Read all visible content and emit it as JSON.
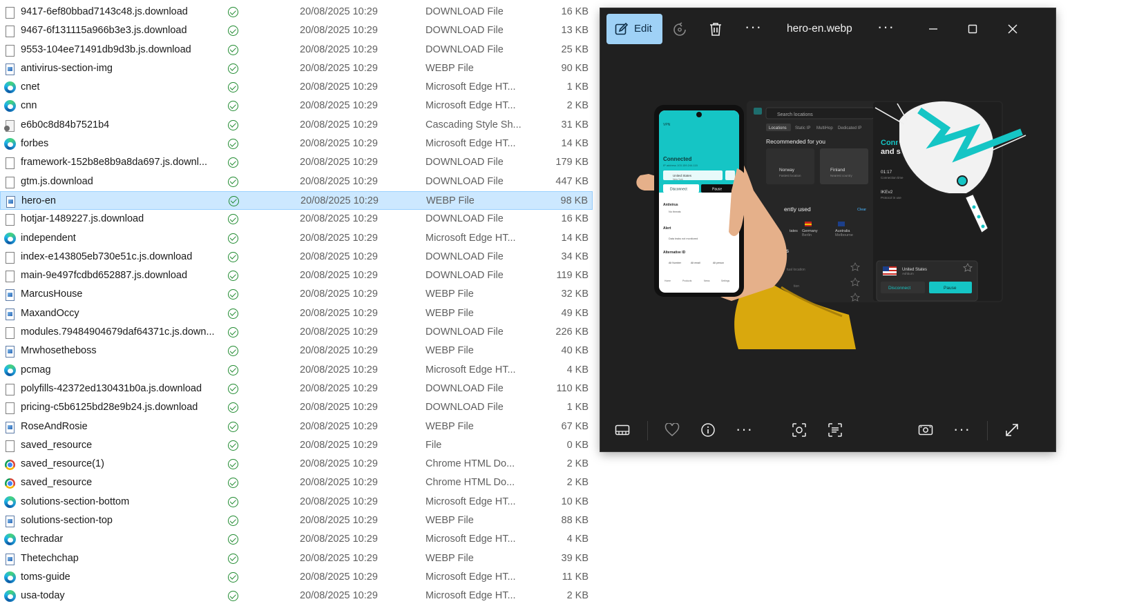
{
  "file_list": {
    "rows": [
      {
        "name": "9417-6ef80bbad7143c48.js.download",
        "icon": "doc",
        "date": "20/08/2025 10:29",
        "type": "DOWNLOAD File",
        "size": "16 KB"
      },
      {
        "name": "9467-6f131115a966b3e3.js.download",
        "icon": "doc",
        "date": "20/08/2025 10:29",
        "type": "DOWNLOAD File",
        "size": "13 KB"
      },
      {
        "name": "9553-104ee71491db9d3b.js.download",
        "icon": "doc",
        "date": "20/08/2025 10:29",
        "type": "DOWNLOAD File",
        "size": "25 KB"
      },
      {
        "name": "antivirus-section-img",
        "icon": "img",
        "date": "20/08/2025 10:29",
        "type": "WEBP File",
        "size": "90 KB"
      },
      {
        "name": "cnet",
        "icon": "edge",
        "date": "20/08/2025 10:29",
        "type": "Microsoft Edge HT...",
        "size": "1 KB"
      },
      {
        "name": "cnn",
        "icon": "edge",
        "date": "20/08/2025 10:29",
        "type": "Microsoft Edge HT...",
        "size": "2 KB"
      },
      {
        "name": "e6b0c8d84b7521b4",
        "icon": "css",
        "date": "20/08/2025 10:29",
        "type": "Cascading Style Sh...",
        "size": "31 KB"
      },
      {
        "name": "forbes",
        "icon": "edge",
        "date": "20/08/2025 10:29",
        "type": "Microsoft Edge HT...",
        "size": "14 KB"
      },
      {
        "name": "framework-152b8e8b9a8da697.js.downl...",
        "icon": "doc",
        "date": "20/08/2025 10:29",
        "type": "DOWNLOAD File",
        "size": "179 KB"
      },
      {
        "name": "gtm.js.download",
        "icon": "doc",
        "date": "20/08/2025 10:29",
        "type": "DOWNLOAD File",
        "size": "447 KB"
      },
      {
        "name": "hero-en",
        "icon": "img",
        "date": "20/08/2025 10:29",
        "type": "WEBP File",
        "size": "98 KB",
        "selected": true
      },
      {
        "name": "hotjar-1489227.js.download",
        "icon": "doc",
        "date": "20/08/2025 10:29",
        "type": "DOWNLOAD File",
        "size": "16 KB"
      },
      {
        "name": "independent",
        "icon": "edge",
        "date": "20/08/2025 10:29",
        "type": "Microsoft Edge HT...",
        "size": "14 KB"
      },
      {
        "name": "index-e143805eb730e51c.js.download",
        "icon": "doc",
        "date": "20/08/2025 10:29",
        "type": "DOWNLOAD File",
        "size": "34 KB"
      },
      {
        "name": "main-9e497fcdbd652887.js.download",
        "icon": "doc",
        "date": "20/08/2025 10:29",
        "type": "DOWNLOAD File",
        "size": "119 KB"
      },
      {
        "name": "MarcusHouse",
        "icon": "img",
        "date": "20/08/2025 10:29",
        "type": "WEBP File",
        "size": "32 KB"
      },
      {
        "name": "MaxandOccy",
        "icon": "img",
        "date": "20/08/2025 10:29",
        "type": "WEBP File",
        "size": "49 KB"
      },
      {
        "name": "modules.79484904679daf64371c.js.down...",
        "icon": "doc",
        "date": "20/08/2025 10:29",
        "type": "DOWNLOAD File",
        "size": "226 KB"
      },
      {
        "name": "Mrwhosetheboss",
        "icon": "img",
        "date": "20/08/2025 10:29",
        "type": "WEBP File",
        "size": "40 KB"
      },
      {
        "name": "pcmag",
        "icon": "edge",
        "date": "20/08/2025 10:29",
        "type": "Microsoft Edge HT...",
        "size": "4 KB"
      },
      {
        "name": "polyfills-42372ed130431b0a.js.download",
        "icon": "doc",
        "date": "20/08/2025 10:29",
        "type": "DOWNLOAD File",
        "size": "110 KB"
      },
      {
        "name": "pricing-c5b6125bd28e9b24.js.download",
        "icon": "doc",
        "date": "20/08/2025 10:29",
        "type": "DOWNLOAD File",
        "size": "1 KB"
      },
      {
        "name": "RoseAndRosie",
        "icon": "img",
        "date": "20/08/2025 10:29",
        "type": "WEBP File",
        "size": "67 KB"
      },
      {
        "name": "saved_resource",
        "icon": "doc",
        "date": "20/08/2025 10:29",
        "type": "File",
        "size": "0 KB"
      },
      {
        "name": "saved_resource(1)",
        "icon": "chrome",
        "date": "20/08/2025 10:29",
        "type": "Chrome HTML Do...",
        "size": "2 KB"
      },
      {
        "name": "saved_resource",
        "icon": "chrome",
        "date": "20/08/2025 10:29",
        "type": "Chrome HTML Do...",
        "size": "2 KB"
      },
      {
        "name": "solutions-section-bottom",
        "icon": "edge",
        "date": "20/08/2025 10:29",
        "type": "Microsoft Edge HT...",
        "size": "10 KB"
      },
      {
        "name": "solutions-section-top",
        "icon": "img",
        "date": "20/08/2025 10:29",
        "type": "WEBP File",
        "size": "88 KB"
      },
      {
        "name": "techradar",
        "icon": "edge",
        "date": "20/08/2025 10:29",
        "type": "Microsoft Edge HT...",
        "size": "4 KB"
      },
      {
        "name": "Thetechchap",
        "icon": "img",
        "date": "20/08/2025 10:29",
        "type": "WEBP File",
        "size": "39 KB"
      },
      {
        "name": "toms-guide",
        "icon": "edge",
        "date": "20/08/2025 10:29",
        "type": "Microsoft Edge HT...",
        "size": "11 KB"
      },
      {
        "name": "usa-today",
        "icon": "edge",
        "date": "20/08/2025 10:29",
        "type": "Microsoft Edge HT...",
        "size": "2 KB"
      }
    ]
  },
  "viewer": {
    "title": "hero-en.webp",
    "edit_label": "Edit",
    "toolbar_icons": [
      "edit-pen-icon",
      "rotate-icon",
      "trash-icon",
      "more-icon",
      "more-icon",
      "minimize-icon",
      "maximize-icon",
      "close-icon"
    ],
    "bottom_icons": [
      "filmstrip-icon",
      "heart-icon",
      "info-icon",
      "more-icon",
      "visual-search-icon",
      "text-scan-icon",
      "slideshow-icon",
      "more-icon",
      "fullscreen-icon"
    ],
    "image": {
      "phone": {
        "app": "VPN",
        "status": "Connected",
        "ip": "IP address 103.159.244.115",
        "location": "United States",
        "location_sub": "New York",
        "disconnect": "Disconnect",
        "pause": "Pause",
        "sections": [
          {
            "title": "Antivirus",
            "detail": "No threats"
          },
          {
            "title": "Alert",
            "detail": "Data leaks not monitored"
          },
          {
            "title": "Alternative ID",
            "detail": ""
          }
        ],
        "alt_items": [
          "Alt Number",
          "Alt email",
          "Alt person"
        ],
        "nav": [
          "Home",
          "Products",
          "News",
          "Settings"
        ]
      },
      "panel": {
        "search": "Search locations",
        "tabs": [
          "Locations",
          "Static IP",
          "MultiHop",
          "Dedicated IP"
        ],
        "recommended": "Recommended for you",
        "norway": "Norway",
        "norway_sub": "Fastest location",
        "finland": "Finland",
        "finland_sub": "Nearest country",
        "recent": "ently used",
        "clear": "Clear",
        "recent_items": [
          "tates",
          "Germany",
          "Australia"
        ],
        "recent_subs": [
          "",
          "Berlin",
          "Melbourne"
        ],
        "section2": "ns",
        "list_items": [
          "tual location",
          "tion",
          "tion"
        ]
      },
      "connected": {
        "line1": "Connected",
        "line2": "and safe",
        "time": "01:17",
        "time_label": "Connection time",
        "protocol": "IKEv2",
        "protocol_label": "Protocol in use",
        "location": "United States",
        "location_sub": "Ashburn",
        "disconnect": "Disconnect",
        "pause": "Pause"
      },
      "accent": "#15c5c5"
    }
  },
  "colors": {
    "selection_bg": "#cce8ff",
    "edit_bg": "#9fd1f6",
    "viewer_bg": "#202020",
    "check_green": "#1e8a2e"
  }
}
